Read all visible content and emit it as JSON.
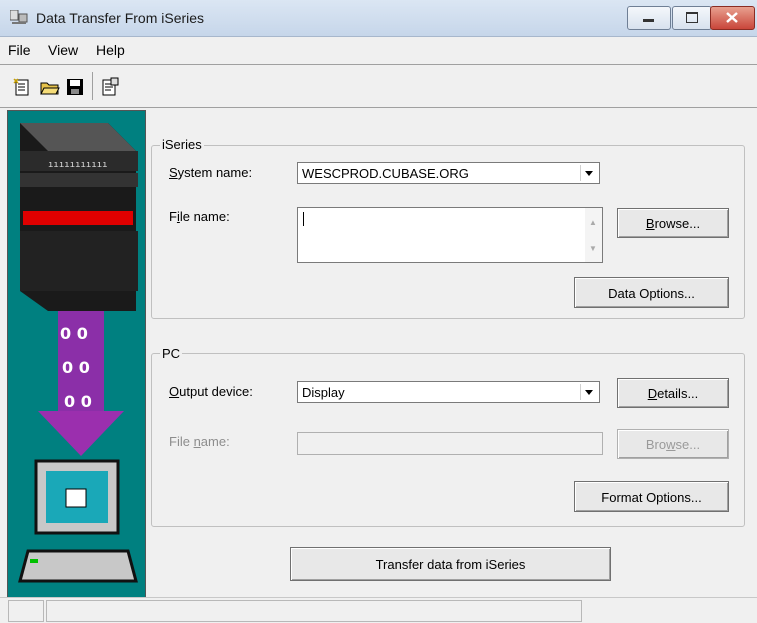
{
  "window": {
    "title": "Data Transfer From iSeries"
  },
  "menu": [
    "File",
    "View",
    "Help"
  ],
  "toolbar": [
    "new-icon",
    "open-icon",
    "save-icon",
    "properties-icon"
  ],
  "iseries": {
    "group_label": "iSeries",
    "system_name_label": "System name:",
    "system_name_value": "WESCPROD.CUBASE.ORG",
    "file_name_label": "File name:",
    "file_name_value": "",
    "browse_label": "Browse...",
    "data_options_label": "Data Options..."
  },
  "pc": {
    "group_label": "PC",
    "output_device_label": "Output device:",
    "output_device_value": "Display",
    "details_label": "Details...",
    "file_name_label": "File name:",
    "file_name_value": "",
    "browse_label": "Browse...",
    "format_options_label": "Format Options..."
  },
  "transfer_label": "Transfer data from iSeries",
  "colors": {
    "panel_bg": "#008080",
    "arrow": "#9b2fae",
    "disk_red": "#ff0000"
  }
}
